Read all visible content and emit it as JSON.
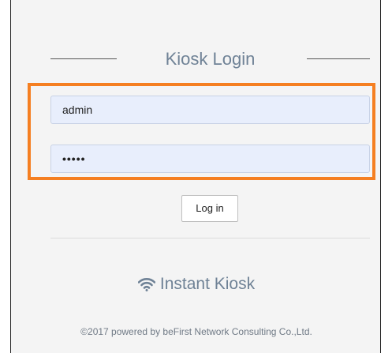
{
  "login": {
    "title": "Kiosk Login",
    "username_value": "admin",
    "password_value": "•••••",
    "submit_label": "Log in"
  },
  "branding": {
    "name": "Instant Kiosk",
    "icon": "wifi-icon",
    "copyright": "©2017 powered by beFirst Network Consulting Co.,Ltd."
  },
  "colors": {
    "highlight": "#f57f21",
    "accent_text": "#6f8296",
    "field_bg": "#e8eefc"
  }
}
